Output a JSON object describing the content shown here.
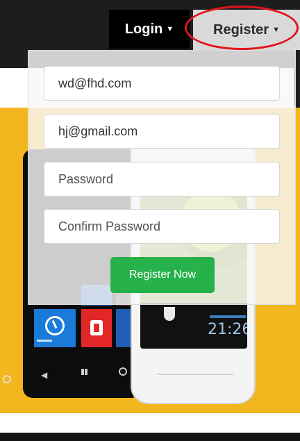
{
  "navbar": {
    "login_label": "Login",
    "register_label": "Register"
  },
  "register_form": {
    "email_value": "wd@fhd.com",
    "second_email_value": "hj@gmail.com",
    "password_placeholder": "Password",
    "confirm_password_placeholder": "Confirm Password",
    "submit_label": "Register Now"
  },
  "hero": {
    "phone_clock_time": "21:26"
  },
  "icons": [
    "caret-down-icon",
    "clock-icon",
    "office-icon",
    "windows-icon",
    "back-icon",
    "search-icon"
  ],
  "colors": {
    "navbar": "#1d1d1d",
    "register_tab": "#d9d9d9",
    "highlight_ring": "#e0141b",
    "hero_background": "#f3b61f",
    "submit_button": "#27b14a"
  }
}
